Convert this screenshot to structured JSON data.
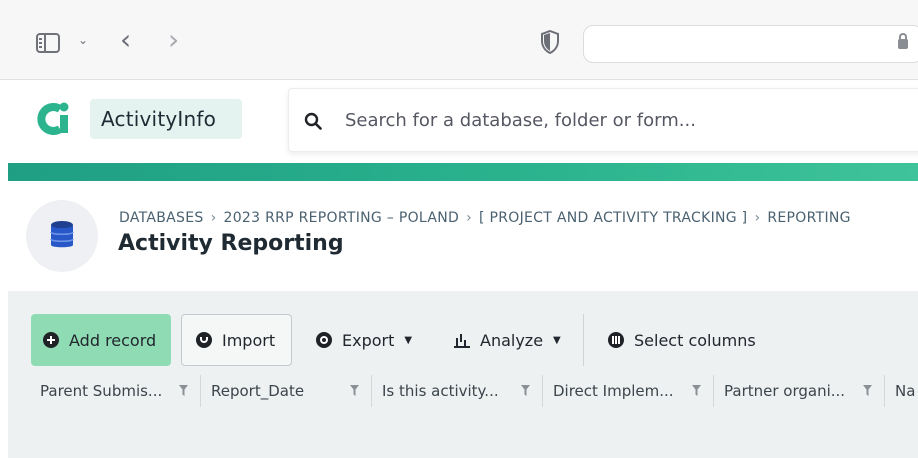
{
  "browser": {
    "sidebar_icon": "sidebar-toggle-icon",
    "back_icon": "chevron-left-icon",
    "forward_icon": "chevron-right-icon",
    "shield_icon": "shield-icon"
  },
  "header": {
    "brand": "ActivityInfo",
    "search_placeholder": "Search for a database, folder or form..."
  },
  "breadcrumb": {
    "items": [
      "DATABASES",
      "2023 RRP REPORTING – POLAND",
      "[ PROJECT AND ACTIVITY TRACKING ]",
      "REPORTING"
    ],
    "separator": "›"
  },
  "page": {
    "title": "Activity Reporting"
  },
  "toolbar": {
    "add_record": "Add record",
    "import": "Import",
    "export": "Export",
    "analyze": "Analyze",
    "select_columns": "Select columns"
  },
  "table": {
    "columns": [
      "Parent Submis...",
      "Report_Date",
      "Is this activity...",
      "Direct Implem...",
      "Partner organi...",
      "Na"
    ]
  },
  "colors": {
    "brand_green": "#2bb48e",
    "add_button": "#8fdcb4",
    "brand_box": "#e4f3f0"
  }
}
